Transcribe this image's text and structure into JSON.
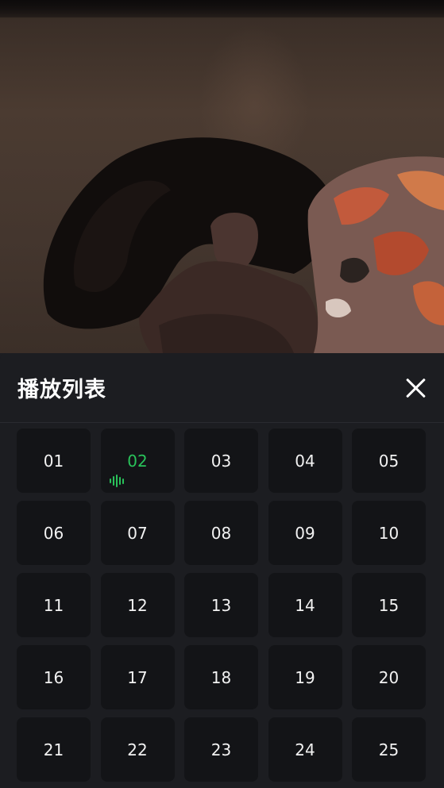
{
  "video": {
    "state": "background-playing"
  },
  "playlist": {
    "title": "播放列表",
    "close_icon": "close-icon",
    "accent_color": "#29c25a",
    "current_episode": "02",
    "episodes": [
      "01",
      "02",
      "03",
      "04",
      "05",
      "06",
      "07",
      "08",
      "09",
      "10",
      "11",
      "12",
      "13",
      "14",
      "15",
      "16",
      "17",
      "18",
      "19",
      "20",
      "21",
      "22",
      "23",
      "24",
      "25"
    ]
  }
}
